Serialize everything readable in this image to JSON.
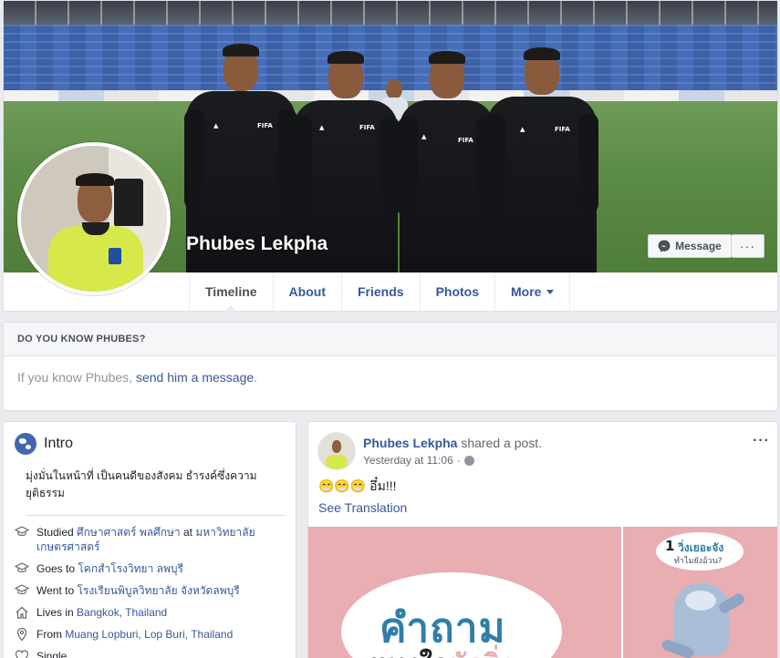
{
  "profile": {
    "name": "Phubes Lekpha"
  },
  "cover_actions": {
    "message_label": "Message",
    "more_label": "···",
    "message_icon": "messenger-icon"
  },
  "tabs": [
    {
      "label": "Timeline",
      "active": true
    },
    {
      "label": "About"
    },
    {
      "label": "Friends"
    },
    {
      "label": "Photos"
    },
    {
      "label": "More"
    }
  ],
  "know_box": {
    "title": "DO YOU KNOW PHUBES?",
    "text_prefix": "If you know Phubes, ",
    "link": "send him a message",
    "text_suffix": "."
  },
  "intro": {
    "title": "Intro",
    "bio": "มุ่งมั่นในหน้าที่ เป็นคนดีของสังคม ธำรงค์ซึ่งความยุติธรรม",
    "items": [
      {
        "icon": "graduation-cap-icon",
        "prefix": "Studied ",
        "link1": "ศึกษาศาสตร์ พลศึกษา",
        "mid": " at ",
        "link2": "มหาวิทยาลัยเกษตรศาสตร์"
      },
      {
        "icon": "graduation-cap-icon",
        "prefix": "Goes to ",
        "link1": "โคกสำโรงวิทยา ลพบุรี"
      },
      {
        "icon": "graduation-cap-icon",
        "prefix": "Went to ",
        "link1": "โรงเรียนพิบูลวิทยาลัย จังหวัดลพบุรี"
      },
      {
        "icon": "home-icon",
        "prefix": "Lives in ",
        "link1": "Bangkok, Thailand"
      },
      {
        "icon": "location-pin-icon",
        "prefix": "From ",
        "link1": "Muang Lopburi, Lop Buri, Thailand"
      },
      {
        "icon": "heart-icon",
        "prefix": "Single"
      }
    ]
  },
  "post": {
    "author": "Phubes Lekpha",
    "action": " shared a post.",
    "time": "Yesterday at 11:06",
    "text": "😁😁😁 อึ๋ม!!!",
    "see_translation": "See Translation",
    "menu": "···",
    "image_left": {
      "headline": "คำถาม",
      "sub1": "แทงใจ",
      "sub2": "นักวิ่ง"
    },
    "image_right": {
      "num": "1",
      "line1": "วิ่งเยอะจัง",
      "line2": "ทำไมยังอ้วน?"
    }
  },
  "colors": {
    "brand": "#4267b2",
    "link": "#365899",
    "background": "#e9ebee"
  }
}
